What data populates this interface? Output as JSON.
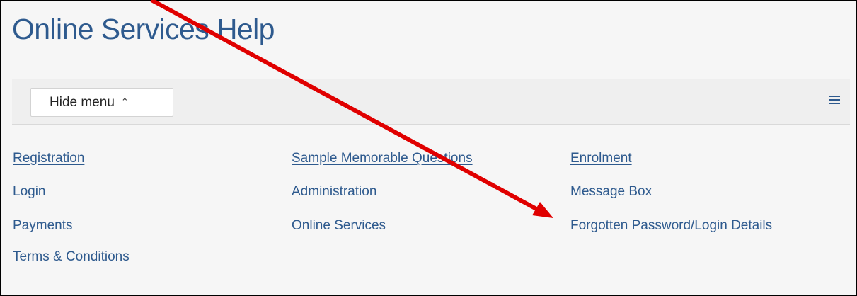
{
  "page": {
    "title": "Online Services Help"
  },
  "menu_bar": {
    "hide_menu_label": "Hide menu",
    "caret_icon": "chevron-up-icon",
    "menu_icon": "hamburger-icon",
    "accent_color": "#2e5a8e"
  },
  "links": {
    "col1": [
      "Registration",
      "Login",
      "Payments",
      "Terms & Conditions"
    ],
    "col2": [
      "Sample Memorable Questions",
      "Administration",
      "Online Services"
    ],
    "col3": [
      "Enrolment",
      "Message Box",
      "Forgotten Password/Login Details"
    ]
  },
  "annotation": {
    "type": "arrow",
    "color": "#e00000",
    "points_to": "Forgotten Password/Login Details"
  }
}
